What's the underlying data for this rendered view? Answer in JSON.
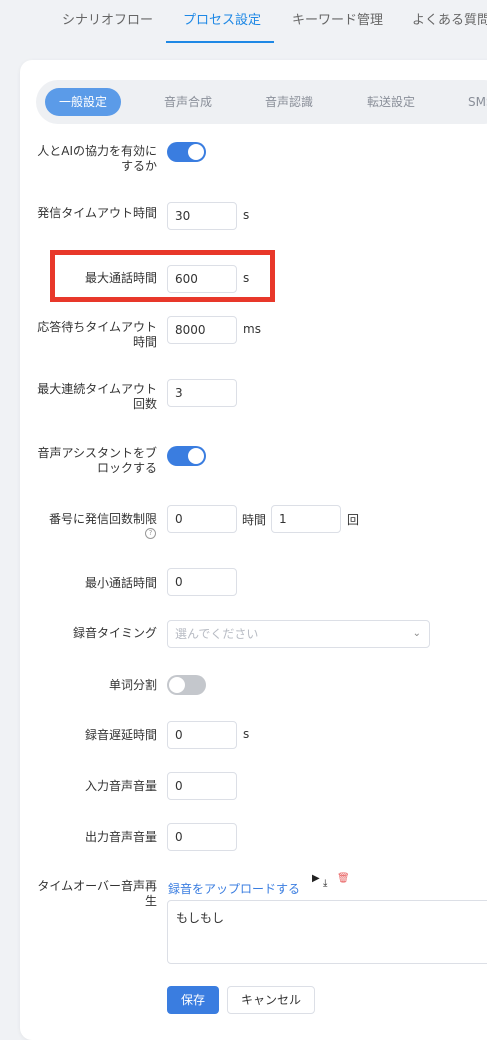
{
  "top_tabs": [
    "シナリオフロー",
    "プロセス設定",
    "キーワード管理",
    "よくある質問"
  ],
  "sub_tabs": [
    "一般設定",
    "音声合成",
    "音声認識",
    "転送設定",
    "SMS"
  ],
  "settings": {
    "ai_cooperation_label": "人とAIの協力を有効にするか",
    "ai_cooperation_enabled": true,
    "call_timeout_label": "発信タイムアウト時間",
    "call_timeout_value": "30",
    "call_timeout_unit": "s",
    "max_call_label": "最大通話時間",
    "max_call_value": "600",
    "max_call_unit": "s",
    "response_wait_label": "応答待ちタイムアウト時間",
    "response_wait_value": "8000",
    "response_wait_unit": "ms",
    "max_consecutive_label": "最大連続タイムアウト回数",
    "max_consecutive_value": "3",
    "block_assistant_label": "音声アシスタントをブロックする",
    "block_assistant_enabled": true,
    "limit_label": "番号に発信回数制限",
    "limit_value": "0",
    "limit_hours_label": "時間",
    "limit_times_value": "1",
    "limit_times_unit": "回",
    "min_call_label": "最小通話時間",
    "min_call_value": "0",
    "rec_timing_label": "録音タイミング",
    "rec_timing_placeholder": "選んでください",
    "word_split_label": "单词分割",
    "word_split_enabled": false,
    "rec_delay_label": "録音遅延時間",
    "rec_delay_value": "0",
    "rec_delay_unit": "s",
    "input_vol_label": "入力音声音量",
    "input_vol_value": "0",
    "output_vol_label": "出力音声音量",
    "output_vol_value": "0",
    "timeout_play_label": "タイムオーバー音声再生",
    "upload_link": "録音をアップロードする",
    "timeout_text": "もしもし"
  },
  "buttons": {
    "save": "保存",
    "cancel": "キャンセル"
  },
  "colors": {
    "accent": "#3a7de0",
    "highlight": "#e8382a"
  }
}
